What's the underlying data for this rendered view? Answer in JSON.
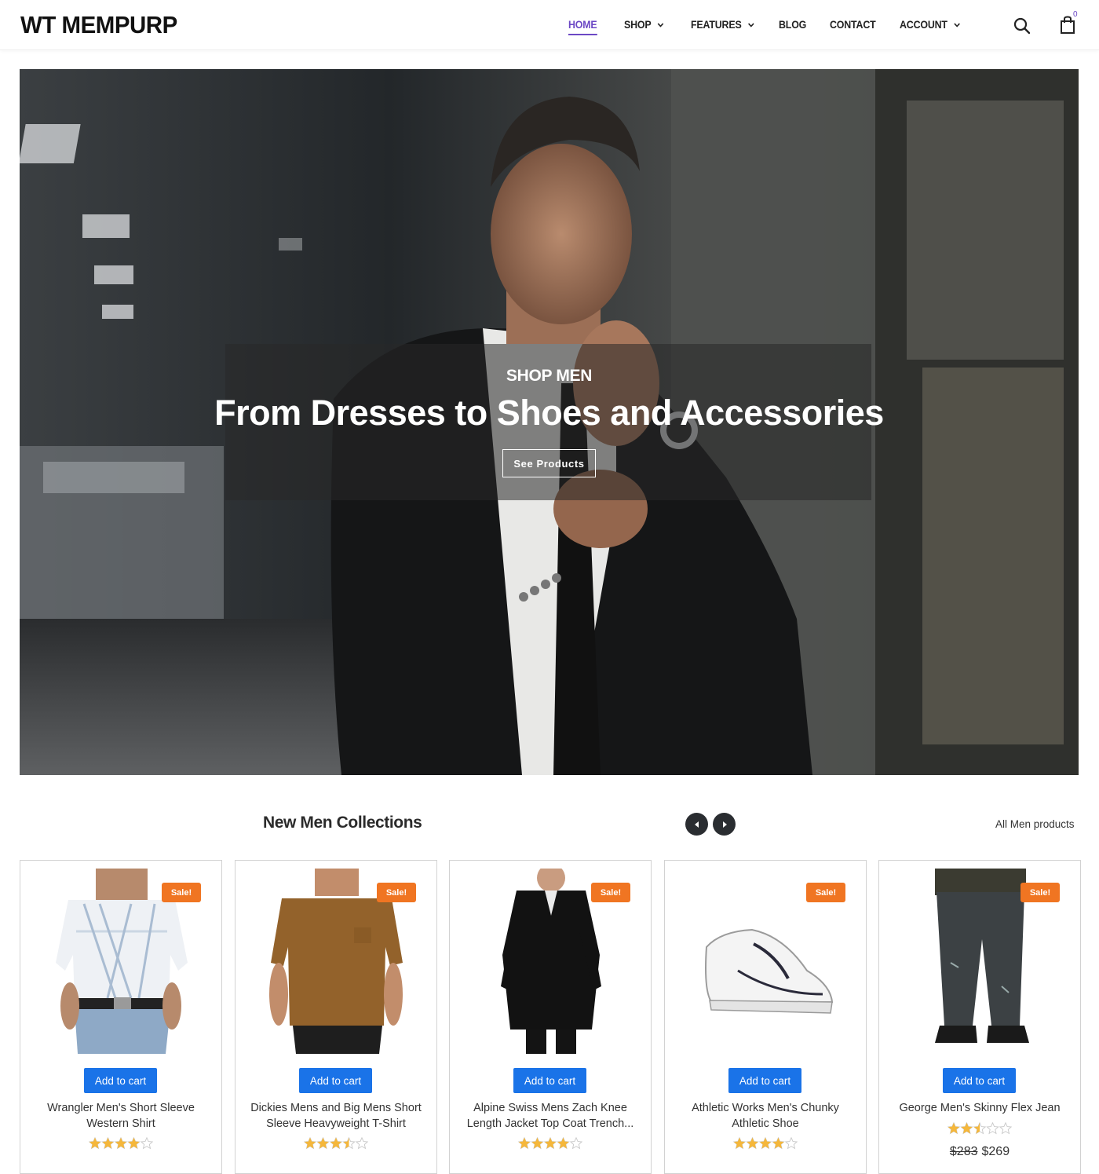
{
  "header": {
    "logo": "WT MEMPURP",
    "nav": [
      {
        "label": "HOME",
        "active": true,
        "dropdown": false
      },
      {
        "label": "SHOP",
        "active": false,
        "dropdown": true
      },
      {
        "label": "FEATURES",
        "active": false,
        "dropdown": true
      },
      {
        "label": "BLOG",
        "active": false,
        "dropdown": false
      },
      {
        "label": "CONTACT",
        "active": false,
        "dropdown": false
      },
      {
        "label": "ACCOUNT",
        "active": false,
        "dropdown": true
      }
    ],
    "search_icon": "search-icon",
    "cart_icon": "shopping-bag-icon",
    "cart_count": "0",
    "accent_color": "#6c48c5"
  },
  "hero": {
    "eyebrow": "SHOP MEN",
    "title": "From Dresses to Shoes and Accessories",
    "button_label": "See Products"
  },
  "collection": {
    "title": "New Men Collections",
    "prev_icon": "chevron-left-icon",
    "next_icon": "chevron-right-icon",
    "all_link": "All Men products",
    "products": [
      {
        "name": "Wrangler Men's Short Sleeve Western Shirt",
        "badge": "Sale!",
        "button": "Add to cart",
        "rating": 4,
        "old_price": "",
        "price": ""
      },
      {
        "name": "Dickies Mens and Big Mens Short Sleeve Heavyweight T-Shirt",
        "badge": "Sale!",
        "button": "Add to cart",
        "rating": 3.5,
        "old_price": "",
        "price": ""
      },
      {
        "name": "Alpine Swiss Mens Zach Knee Length Jacket Top Coat Trench...",
        "badge": "Sale!",
        "button": "Add to cart",
        "rating": 4,
        "old_price": "",
        "price": ""
      },
      {
        "name": "Athletic Works Men's Chunky Athletic Shoe",
        "badge": "Sale!",
        "button": "Add to cart",
        "rating": 4,
        "old_price": "",
        "price": ""
      },
      {
        "name": "George Men's Skinny Flex Jean",
        "badge": "Sale!",
        "button": "Add to cart",
        "rating": 2.5,
        "old_price": "$283",
        "price": "$269"
      }
    ]
  },
  "colors": {
    "sale_badge": "#f07522",
    "add_to_cart": "#1a73e8",
    "star": "#f5b73b",
    "carousel_button": "#2a2d31"
  }
}
